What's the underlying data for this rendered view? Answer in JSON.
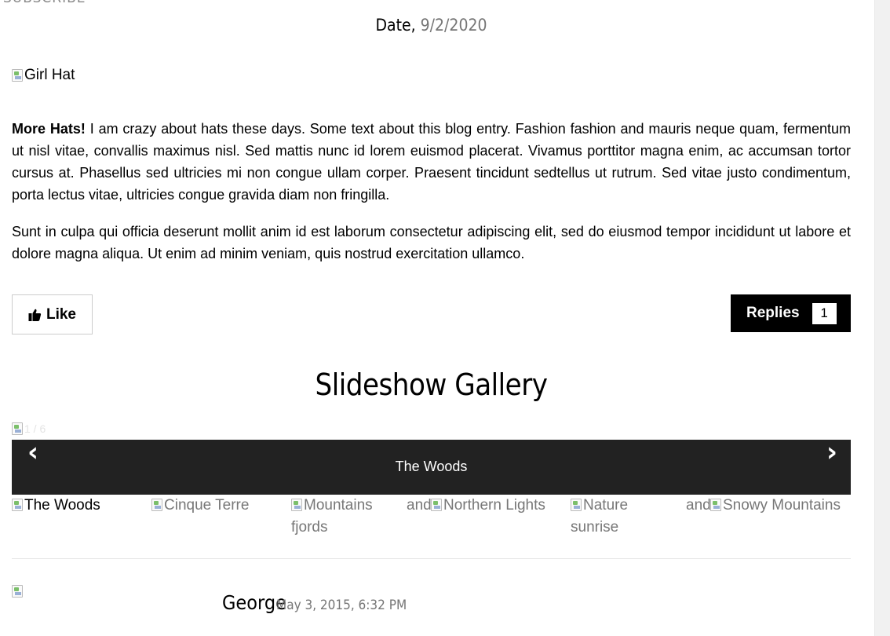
{
  "header": {
    "cut_label": "SUBSCRIBE"
  },
  "post": {
    "date_label": "Date,",
    "date_value": "9/2/2020",
    "image_alt": "Girl Hat",
    "title": "More Hats!",
    "body1": " I am crazy about hats these days. Some text about this blog entry. Fashion fashion and mauris neque quam, fermentum ut nisl vitae, convallis maximus nisl. Sed mattis nunc id lorem euismod placerat. Vivamus porttitor magna enim, ac accumsan tortor cursus at. Phasellus sed ultricies mi non congue ullam corper. Praesent tincidunt sedtellus ut rutrum. Sed vitae justo condimentum, porta lectus vitae, ultricies congue gravida diam non fringilla.",
    "body2": "Sunt in culpa qui officia deserunt mollit anim id est laborum consectetur adipiscing elit, sed do eiusmod tempor incididunt ut labore et dolore magna aliqua. Ut enim ad minim veniam, quis nostrud exercitation ullamco.",
    "like_label": "Like",
    "replies_label": "Replies",
    "replies_count": "1"
  },
  "gallery": {
    "title": "Slideshow Gallery",
    "counter": "1 / 6",
    "caption": "The Woods",
    "prev_glyph": "‹",
    "next_glyph": "›",
    "thumbs": [
      "The Woods",
      "Cinque Terre",
      "Mountains and fjords",
      "Northern Lights",
      "Nature and sunrise",
      "Snowy Mountains"
    ],
    "thumb_1_line1": "Mountains",
    "thumb_1_line2": "fjords",
    "thumb_4_line1": "Nature",
    "thumb_4_line2": "sunrise",
    "and_word": "and"
  },
  "comment": {
    "name": "George",
    "date": "May 3, 2015, 6:32 PM"
  },
  "colors": {
    "accent": "#000000",
    "muted": "#757575",
    "slide_bar": "#222222"
  },
  "icons": {
    "like": "thumbs-up-icon",
    "broken": "broken-image-icon"
  }
}
